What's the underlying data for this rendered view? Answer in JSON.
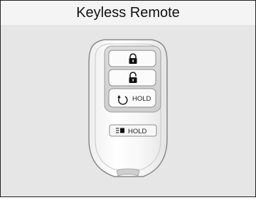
{
  "title": "Keyless Remote",
  "remote": {
    "buttons": [
      {
        "name": "lock",
        "icon": "lock-icon"
      },
      {
        "name": "unlock",
        "icon": "unlock-icon"
      },
      {
        "name": "remote-start",
        "icon": "remote-start-icon",
        "label": "HOLD"
      },
      {
        "name": "trunk",
        "icon": "trunk-icon",
        "label": "HOLD"
      }
    ]
  }
}
